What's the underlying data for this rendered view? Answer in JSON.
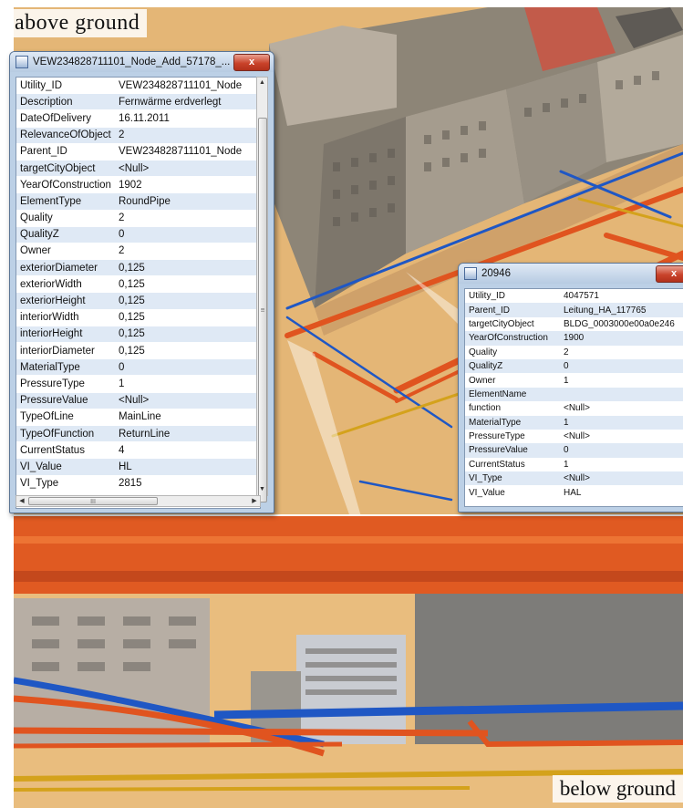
{
  "captions": {
    "above": "above ground",
    "below": "below ground"
  },
  "colors": {
    "ground": "#e6b877",
    "pipe_orange": "#e0541f",
    "pipe_blue": "#1f57c4",
    "pipe_yellow": "#d4a21c",
    "window_frame": "#bcd0e6",
    "row_alt": "#dfe9f5",
    "close_button": "#c9432b"
  },
  "node_window": {
    "title": "VEW234828711101_Node_Add_57178_...",
    "close_icon": "x",
    "rows": [
      {
        "key": "Utility_ID",
        "value": "VEW234828711101_Node"
      },
      {
        "key": "Description",
        "value": "Fernwärme erdverlegt"
      },
      {
        "key": "DateOfDelivery",
        "value": "16.11.2011"
      },
      {
        "key": "RelevanceOfObject",
        "value": "2"
      },
      {
        "key": "Parent_ID",
        "value": "VEW234828711101_Node"
      },
      {
        "key": "targetCityObject",
        "value": "<Null>"
      },
      {
        "key": "YearOfConstruction",
        "value": "1902"
      },
      {
        "key": "ElementType",
        "value": "RoundPipe"
      },
      {
        "key": "Quality",
        "value": "2"
      },
      {
        "key": "QualityZ",
        "value": "0"
      },
      {
        "key": "Owner",
        "value": "2"
      },
      {
        "key": "exteriorDiameter",
        "value": "0,125"
      },
      {
        "key": "exteriorWidth",
        "value": "0,125"
      },
      {
        "key": "exteriorHeight",
        "value": "0,125"
      },
      {
        "key": "interiorWidth",
        "value": "0,125"
      },
      {
        "key": "interiorHeight",
        "value": "0,125"
      },
      {
        "key": "interiorDiameter",
        "value": "0,125"
      },
      {
        "key": "MaterialType",
        "value": "0"
      },
      {
        "key": "PressureType",
        "value": "1"
      },
      {
        "key": "PressureValue",
        "value": "<Null>"
      },
      {
        "key": "TypeOfLine",
        "value": "MainLine"
      },
      {
        "key": "TypeOfFunction",
        "value": "ReturnLine"
      },
      {
        "key": "CurrentStatus",
        "value": "4"
      },
      {
        "key": "VI_Value",
        "value": "HL"
      },
      {
        "key": "VI_Type",
        "value": "2815"
      }
    ],
    "scroll_up_icon": "▲",
    "scroll_down_icon": "▼",
    "scroll_left_icon": "◀",
    "scroll_right_icon": "▶",
    "vscroll_grip": "≡",
    "hscroll_grip": "III"
  },
  "feature_window": {
    "title": "20946",
    "close_icon": "x",
    "rows": [
      {
        "key": "Utility_ID",
        "value": "4047571"
      },
      {
        "key": "Parent_ID",
        "value": "Leitung_HA_117765"
      },
      {
        "key": "targetCityObject",
        "value": "BLDG_0003000e00a0e246"
      },
      {
        "key": "YearOfConstruction",
        "value": "1900"
      },
      {
        "key": "Quality",
        "value": "2"
      },
      {
        "key": "QualityZ",
        "value": "0"
      },
      {
        "key": "Owner",
        "value": "1"
      },
      {
        "key": "ElementName",
        "value": ""
      },
      {
        "key": "function",
        "value": "<Null>"
      },
      {
        "key": "MaterialType",
        "value": "1"
      },
      {
        "key": "PressureType",
        "value": "<Null>"
      },
      {
        "key": "PressureValue",
        "value": "0"
      },
      {
        "key": "CurrentStatus",
        "value": "1"
      },
      {
        "key": "VI_Type",
        "value": "<Null>"
      },
      {
        "key": "VI_Value",
        "value": "HAL"
      }
    ]
  }
}
